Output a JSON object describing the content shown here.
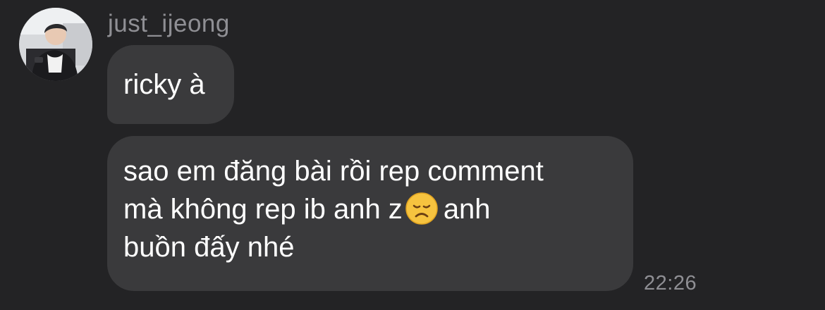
{
  "chat": {
    "sender": {
      "username": "just_ijeong",
      "avatar_icon": "profile-photo"
    },
    "messages": [
      {
        "lines": [
          "ricky à"
        ]
      },
      {
        "lines": [
          "sao em đăng bài rồi rep comment",
          "mà không rep ib anh z",
          "anh",
          "buồn đấy nhé"
        ],
        "emoji": "disappointed-face-emoji",
        "timestamp": "22:26"
      }
    ]
  },
  "colors": {
    "background": "#232325",
    "bubble": "#3a3a3c",
    "text": "#ffffff",
    "meta_text": "#8f8f94"
  }
}
